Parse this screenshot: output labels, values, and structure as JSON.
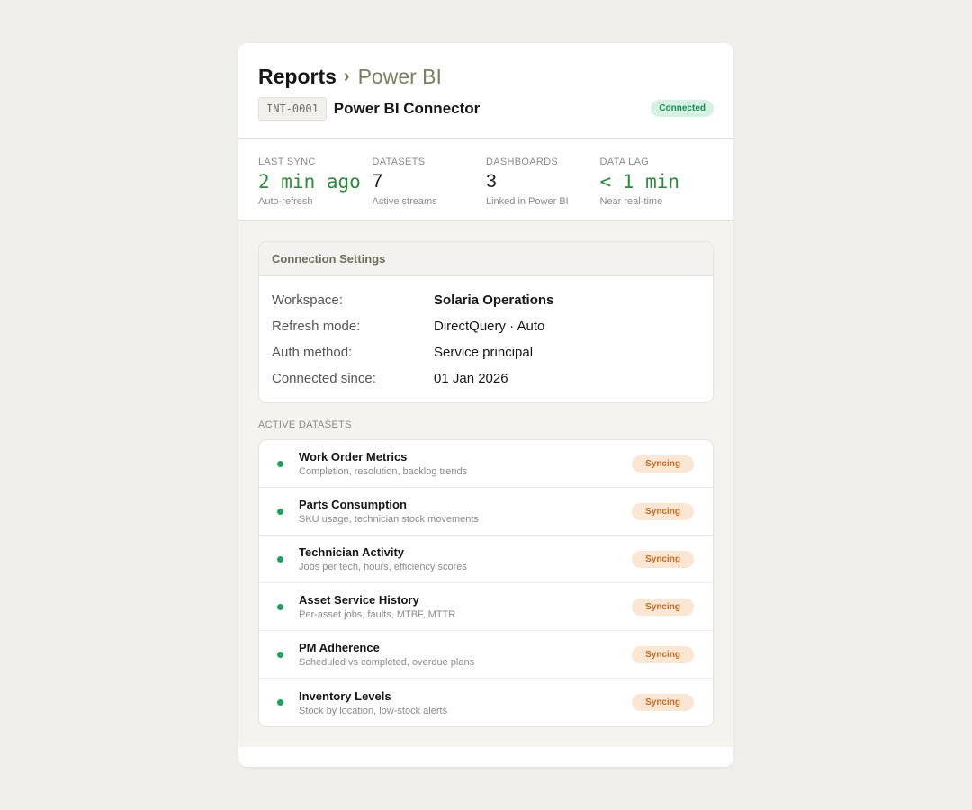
{
  "breadcrumb": {
    "root": "Reports",
    "separator": "›",
    "current": "Power BI"
  },
  "connector": {
    "code": "INT-0001",
    "name": "Power BI Connector",
    "status": "Connected"
  },
  "stats": [
    {
      "label": "LAST SYNC",
      "value": "2 min ago",
      "sub": "Auto-refresh"
    },
    {
      "label": "DATASETS",
      "value": "7",
      "sub": "Active streams"
    },
    {
      "label": "DASHBOARDS",
      "value": "3",
      "sub": "Linked in Power BI"
    },
    {
      "label": "DATA LAG",
      "value": "< 1 min",
      "sub": "Near real-time"
    }
  ],
  "settings": {
    "title": "Connection Settings",
    "rows": [
      {
        "key": "Workspace:",
        "value": "Solaria Operations"
      },
      {
        "key": "Refresh mode:",
        "value": "DirectQuery · Auto"
      },
      {
        "key": "Auth method:",
        "value": "Service principal"
      },
      {
        "key": "Connected since:",
        "value": "01 Jan 2026"
      }
    ]
  },
  "datasets": {
    "label": "ACTIVE DATASETS",
    "items": [
      {
        "name": "Work Order Metrics",
        "desc": "Completion, resolution, backlog trends",
        "status": "Syncing"
      },
      {
        "name": "Parts Consumption",
        "desc": "SKU usage, technician stock movements",
        "status": "Syncing"
      },
      {
        "name": "Technician Activity",
        "desc": "Jobs per tech, hours, efficiency scores",
        "status": "Syncing"
      },
      {
        "name": "Asset Service History",
        "desc": "Per-asset jobs, faults, MTBF, MTTR",
        "status": "Syncing"
      },
      {
        "name": "PM Adherence",
        "desc": "Scheduled vs completed, overdue plans",
        "status": "Syncing"
      },
      {
        "name": "Inventory Levels",
        "desc": "Stock by location, low-stock alerts",
        "status": "Syncing"
      }
    ]
  },
  "colors": {
    "accent_green": "#2c8a3c",
    "connected_bg": "#d4f1e2",
    "syncing_text": "#c06a1f",
    "syncing_bg": "#fbe6d4",
    "dot_green": "#18a35e"
  }
}
